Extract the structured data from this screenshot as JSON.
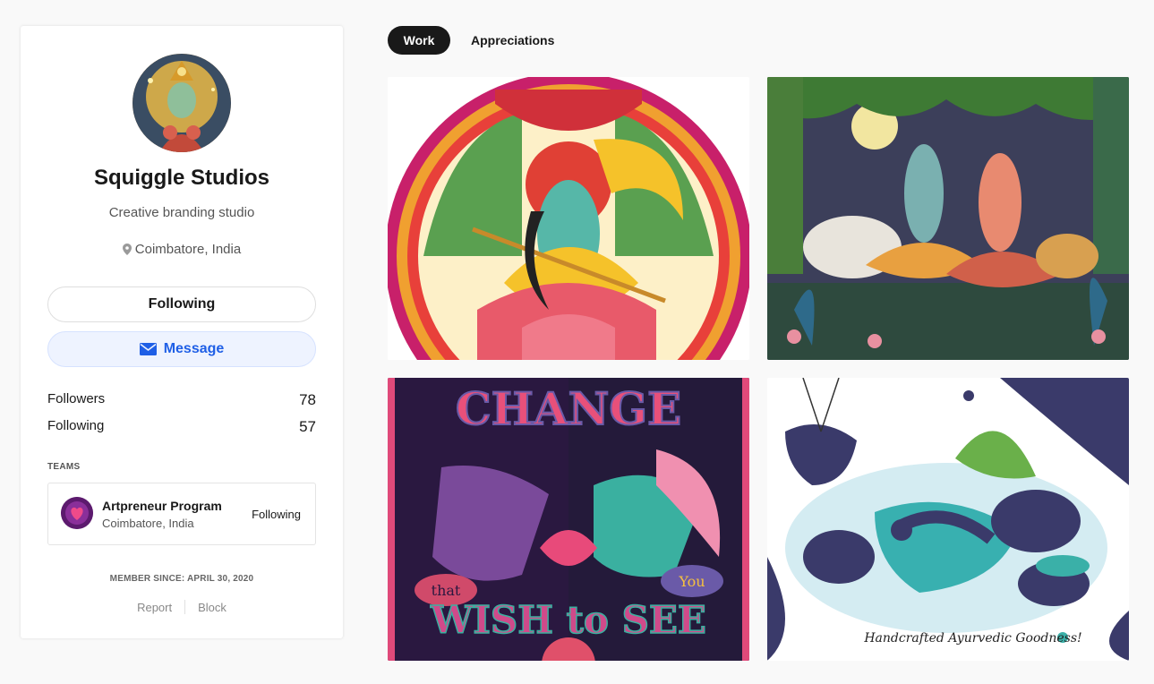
{
  "profile": {
    "name": "Squiggle Studios",
    "tagline": "Creative branding studio",
    "location": "Coimbatore, India",
    "following_button": "Following",
    "message_button": "Message"
  },
  "stats": [
    {
      "label": "Followers",
      "value": "78"
    },
    {
      "label": "Following",
      "value": "57"
    }
  ],
  "teams": {
    "label": "TEAMS",
    "items": [
      {
        "name": "Artpreneur Program",
        "location": "Coimbatore, India",
        "status": "Following"
      }
    ]
  },
  "member_since": "MEMBER SINCE: APRIL 30, 2020",
  "footer": {
    "report": "Report",
    "block": "Block"
  },
  "tabs": [
    {
      "label": "Work",
      "active": true
    },
    {
      "label": "Appreciations",
      "active": false
    }
  ],
  "gallery": {
    "tile3_text": {
      "top": "CHANGE",
      "left": "that",
      "right": "You",
      "bottom": "WISH to SEE"
    },
    "tile4_caption": "Handcrafted Ayurvedic Goodness!"
  },
  "colors": {
    "accent": "#1f5fe6",
    "active_tab": "#191919",
    "message_bg": "#eef3ff"
  }
}
